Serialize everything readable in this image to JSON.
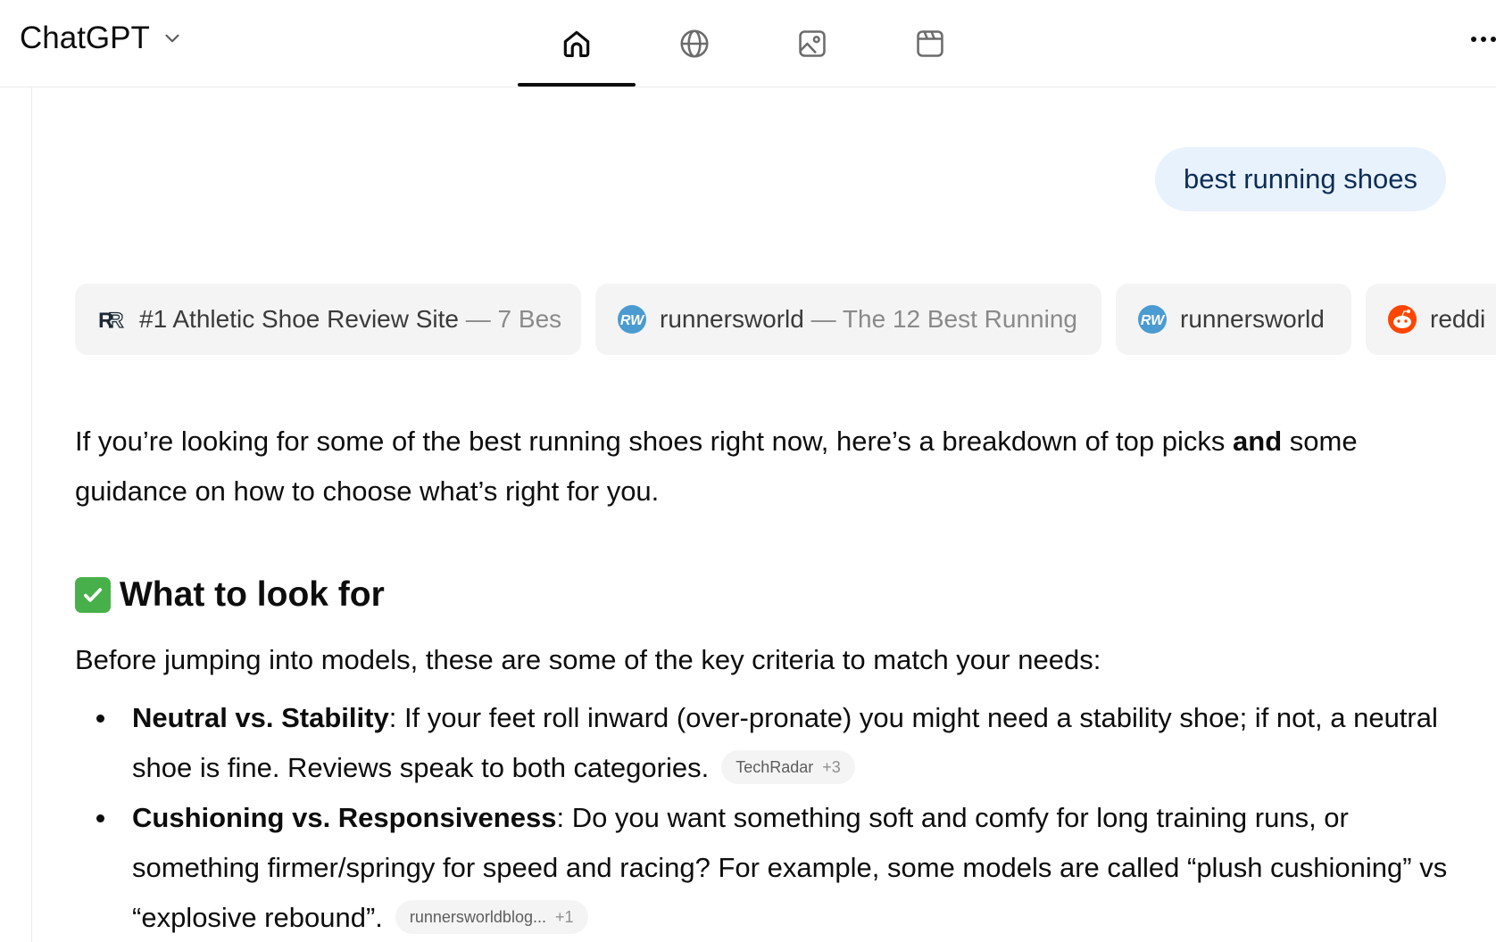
{
  "header": {
    "app_title": "ChatGPT",
    "tabs": [
      {
        "name": "home",
        "icon": "home-icon",
        "active": true
      },
      {
        "name": "web",
        "icon": "globe-icon",
        "active": false
      },
      {
        "name": "images",
        "icon": "image-icon",
        "active": false
      },
      {
        "name": "videos",
        "icon": "video-icon",
        "active": false
      }
    ],
    "more_icon": "more-horizontal-icon"
  },
  "user_message": "best running shoes",
  "sources": [
    {
      "favicon": "rr-logo-icon",
      "site": "#1 Athletic Shoe Review Site",
      "separator": " — ",
      "title": "7 Bes"
    },
    {
      "favicon": "runnersworld-logo-icon",
      "site": "runnersworld",
      "separator": " — ",
      "title": "The 12 Best Running"
    },
    {
      "favicon": "runnersworld-logo-icon",
      "site": "runnersworld",
      "separator": "",
      "title": ""
    },
    {
      "favicon": "reddit-logo-icon",
      "site": "reddi",
      "separator": "",
      "title": ""
    }
  ],
  "answer": {
    "intro_part1": "If you’re looking for some of the best running shoes right now, here’s a breakdown of top picks ",
    "intro_bold": "and",
    "intro_part2": " some guidance on how to choose what’s right for you.",
    "section_heading": "What to look for",
    "section_icon": "check-mark-button-icon",
    "lead": "Before jumping into models, these are some of the key criteria to match your needs:",
    "bullets": [
      {
        "term": "Neutral vs. Stability",
        "text": ": If your feet roll inward (over-pronate) you might need a stability shoe; if not, a neutral shoe is fine. Reviews speak to both categories.",
        "citation": {
          "source": "TechRadar",
          "count": "+3"
        }
      },
      {
        "term": "Cushioning vs. Responsiveness",
        "text": ": Do you want something soft and comfy for long training runs, or something firmer/springy for speed and racing? For example, some models are called “plush cushioning” vs “explosive rebound”.",
        "citation": {
          "source": "runnersworldblog...",
          "count": "+1"
        }
      }
    ]
  },
  "colors": {
    "user_bubble_bg": "#e8f2fd",
    "chip_bg": "#f4f4f4",
    "check_green": "#48b04a",
    "runnersworld_blue": "#4a9bd1",
    "reddit_orange": "#ff4500"
  }
}
